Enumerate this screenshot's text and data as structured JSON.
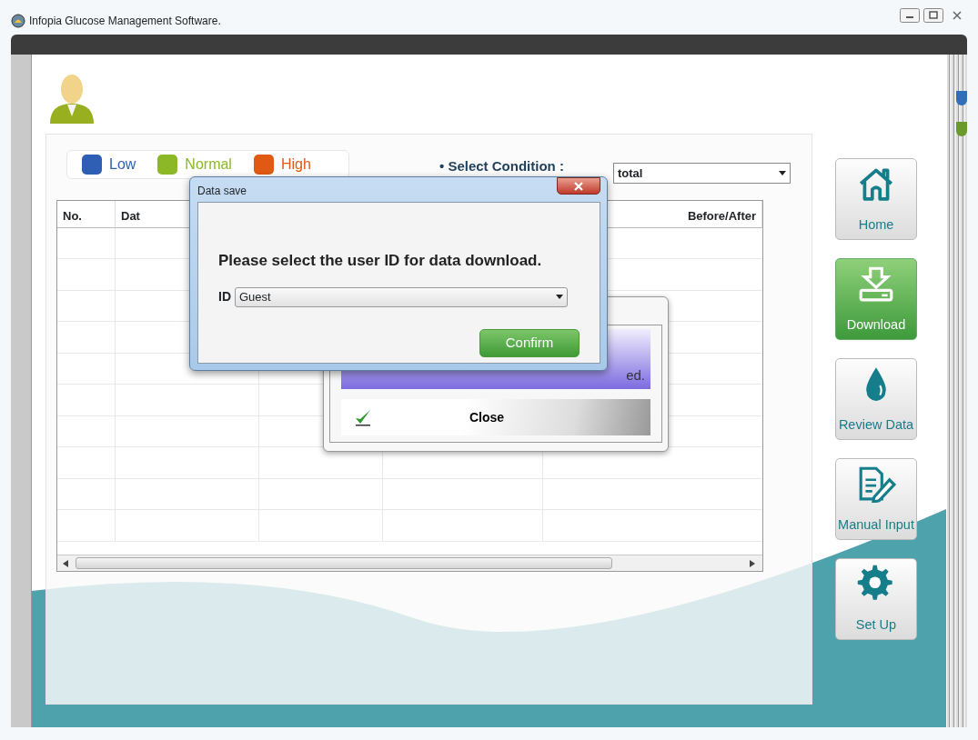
{
  "window": {
    "title": "Infopia Glucose Management Software."
  },
  "legend": [
    {
      "label": "Low",
      "color": "#2f5fb4"
    },
    {
      "label": "Normal",
      "color": "#8cb828"
    },
    {
      "label": "High",
      "color": "#e05a14"
    }
  ],
  "condition": {
    "label": "• Select Condition :",
    "value": "total"
  },
  "table": {
    "columns": [
      {
        "label": "No."
      },
      {
        "label": "Dat"
      },
      {
        "label": "Before/After"
      }
    ]
  },
  "nav": [
    {
      "label": "Home",
      "selected": false
    },
    {
      "label": "Download",
      "selected": true
    },
    {
      "label": "Review Data",
      "selected": false
    },
    {
      "label": "Manual Input",
      "selected": false
    },
    {
      "label": "Set Up",
      "selected": false
    }
  ],
  "notice_dialog": {
    "message": "ed.",
    "button": "Close"
  },
  "data_save_dialog": {
    "title": "Data save",
    "prompt": "Please select the user ID for data download.",
    "id_label": "ID",
    "id_value": "Guest",
    "button": "Confirm"
  }
}
